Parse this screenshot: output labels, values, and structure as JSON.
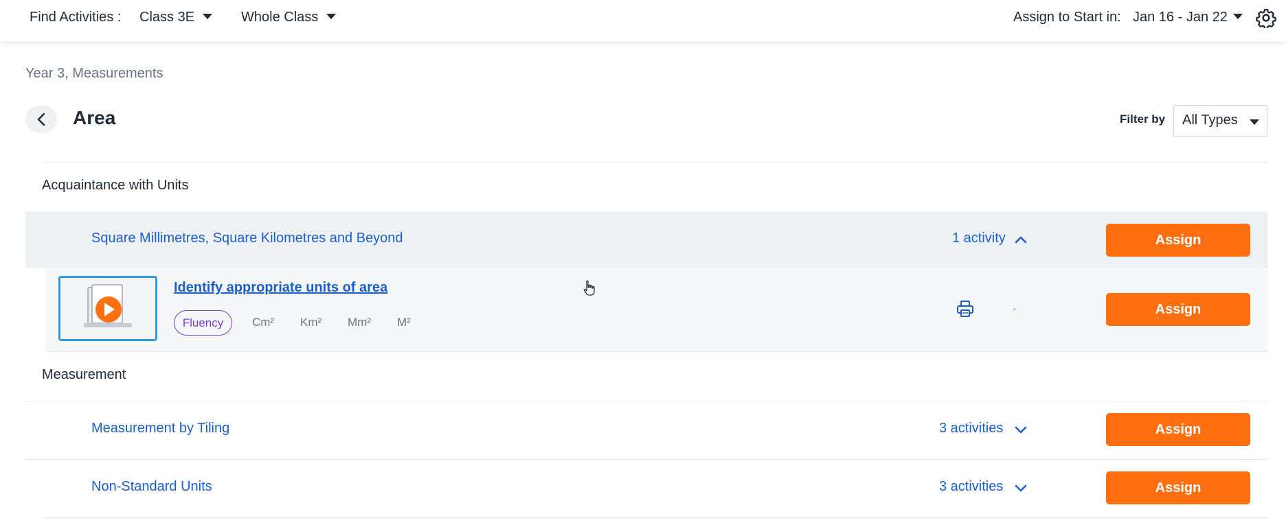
{
  "topbar": {
    "find_label": "Find Activities :",
    "class_value": "Class 3E",
    "group_value": "Whole Class",
    "assign_start_label": "Assign to Start in:",
    "date_range": "Jan 16 - Jan 22"
  },
  "breadcrumb": "Year 3, Measurements",
  "page": {
    "title": "Area",
    "filter_label": "Filter by",
    "filter_value": "All Types"
  },
  "sections": [
    {
      "title": "Acquaintance with Units",
      "topics": [
        {
          "name": "Square Millimetres, Square Kilometres and Beyond",
          "count": "1 activity",
          "assign": "Assign",
          "activities": [
            {
              "title": "Identify appropriate units of area",
              "tag": "Fluency",
              "keywords": [
                "Cm²",
                "Km²",
                "Mm²",
                "M²"
              ],
              "status": "-",
              "assign": "Assign"
            }
          ]
        }
      ]
    },
    {
      "title": "Measurement",
      "topics": [
        {
          "name": "Measurement by Tiling",
          "count": "3 activities",
          "assign": "Assign"
        },
        {
          "name": "Non-Standard Units",
          "count": "3 activities",
          "assign": "Assign"
        }
      ]
    }
  ],
  "colors": {
    "accent_orange": "#ff6f0f",
    "link_blue": "#1a5fc9",
    "fluency_purple": "#7b3fd1",
    "thumb_border": "#2b9de8"
  }
}
